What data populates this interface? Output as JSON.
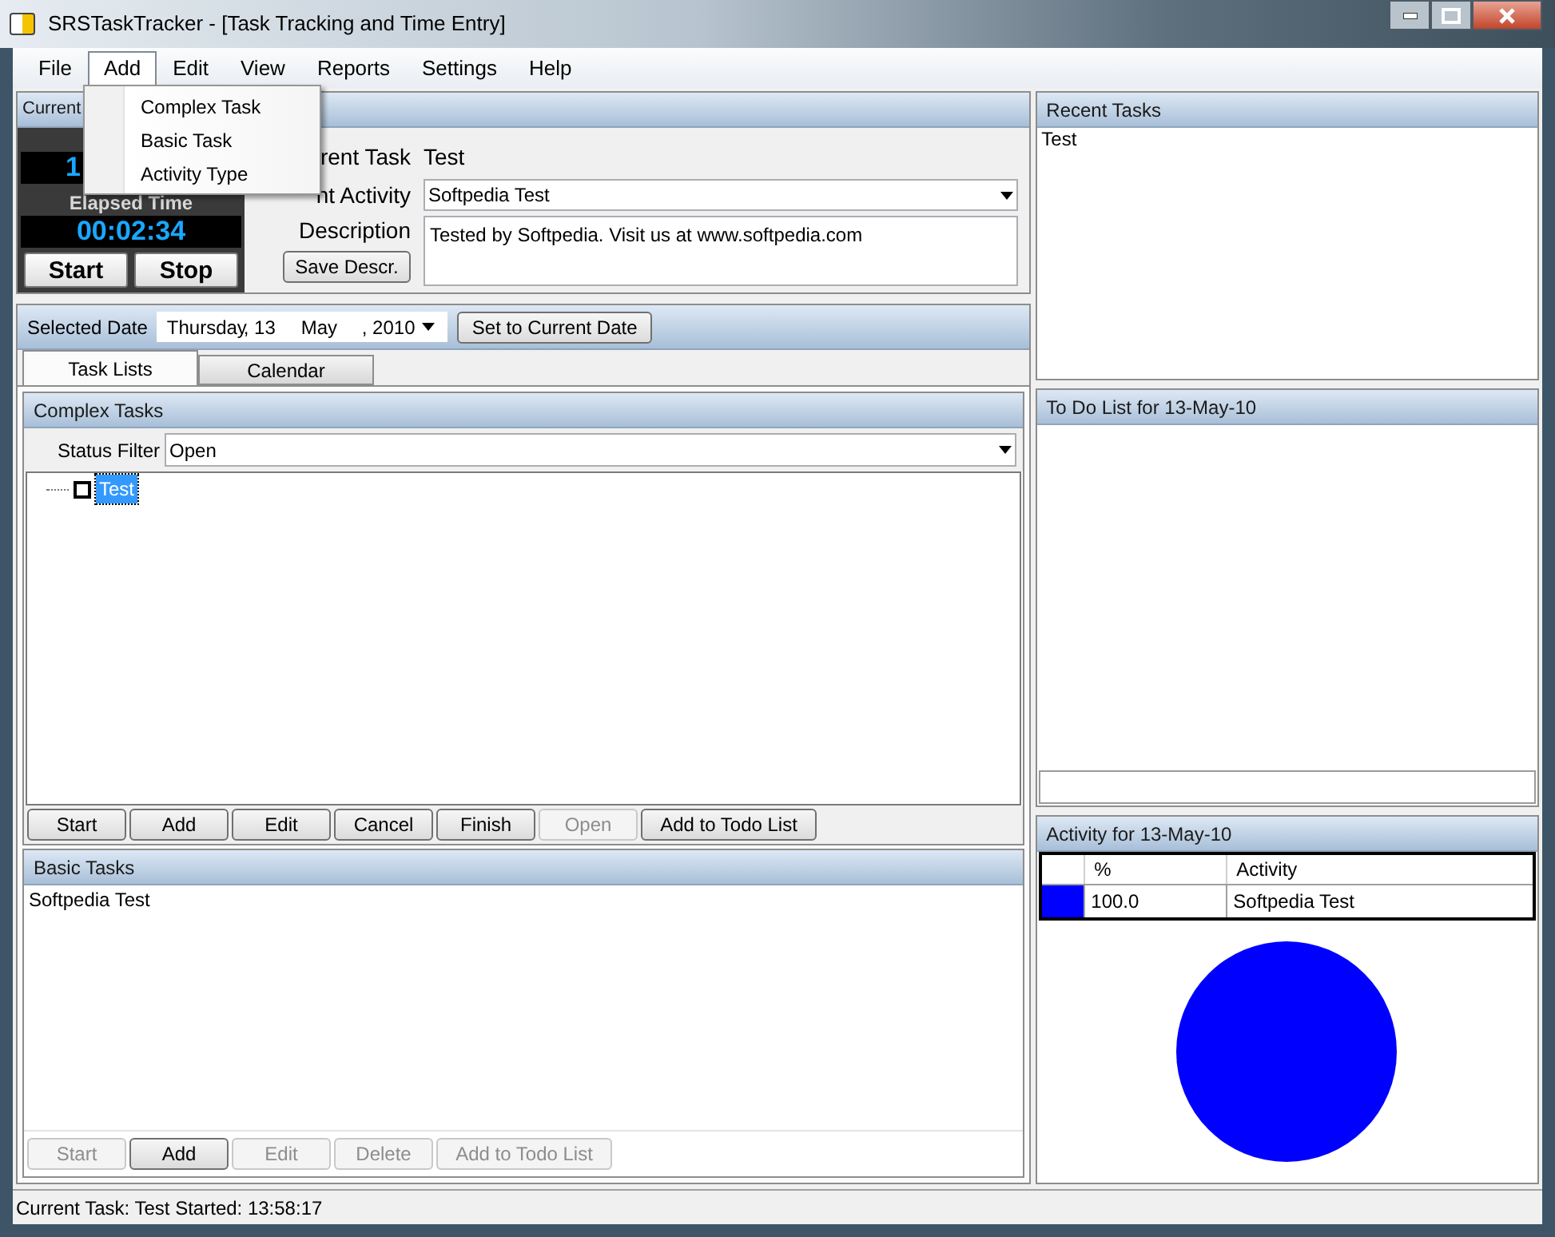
{
  "window": {
    "title": "SRSTaskTracker - [Task Tracking and Time Entry]"
  },
  "menu": [
    {
      "label": "File",
      "selected": false
    },
    {
      "label": "Add",
      "selected": true
    },
    {
      "label": "Edit",
      "selected": false
    },
    {
      "label": "View",
      "selected": false
    },
    {
      "label": "Reports",
      "selected": false
    },
    {
      "label": "Settings",
      "selected": false
    },
    {
      "label": "Help",
      "selected": false
    }
  ],
  "open_menu": {
    "items": [
      "Complex Task",
      "Basic Task",
      "Activity Type"
    ]
  },
  "current_panel": {
    "title": "Current",
    "clock": "1",
    "elapsed_label": "Elapsed Time",
    "elapsed": "00:02:34",
    "buttons": [
      "Start",
      "Stop"
    ],
    "task_label": "rent Task",
    "task_value": "Test",
    "activity_label": "nt Activity",
    "activity_value": "Softpedia Test",
    "description_label": "Description",
    "description": "Tested by Softpedia. Visit us at www.softpedia.com",
    "save_button": "Save Descr."
  },
  "date_bar": {
    "label": "Selected Date",
    "weekday": "Thursday",
    "day": ", 13",
    "month": "May",
    "year": ", 2010",
    "button": "Set to Current Date"
  },
  "tabs": [
    {
      "label": "Task Lists",
      "selected": true
    },
    {
      "label": "Calendar",
      "selected": false
    }
  ],
  "complex_tasks": {
    "title": "Complex Tasks",
    "filter_label": "Status Filter",
    "filter_value": "Open",
    "tree": [
      {
        "label": "Test",
        "checked": false,
        "selected": true
      }
    ],
    "buttons": [
      {
        "label": "Start",
        "disabled": false
      },
      {
        "label": "Add",
        "disabled": false
      },
      {
        "label": "Edit",
        "disabled": false
      },
      {
        "label": "Cancel",
        "disabled": false
      },
      {
        "label": "Finish",
        "disabled": false
      },
      {
        "label": "Open",
        "disabled": true
      },
      {
        "label": "Add to Todo List",
        "disabled": false
      }
    ]
  },
  "basic_tasks": {
    "title": "Basic Tasks",
    "items": [
      "Softpedia Test"
    ],
    "buttons": [
      {
        "label": "Start",
        "disabled": true
      },
      {
        "label": "Add",
        "disabled": false
      },
      {
        "label": "Edit",
        "disabled": true
      },
      {
        "label": "Delete",
        "disabled": true
      },
      {
        "label": "Add to Todo List",
        "disabled": true
      }
    ]
  },
  "recent_tasks": {
    "title": "Recent Tasks",
    "items": [
      "Test"
    ]
  },
  "todo": {
    "title": "To Do List for 13-May-10"
  },
  "activity": {
    "title": "Activity for 13-May-10",
    "columns": [
      "%",
      "Activity"
    ],
    "rows": [
      {
        "color": "#0000ff",
        "percent": "100.0",
        "activity": "Softpedia Test"
      }
    ]
  },
  "status_bar": "Current Task: Test Started: 13:58:17"
}
